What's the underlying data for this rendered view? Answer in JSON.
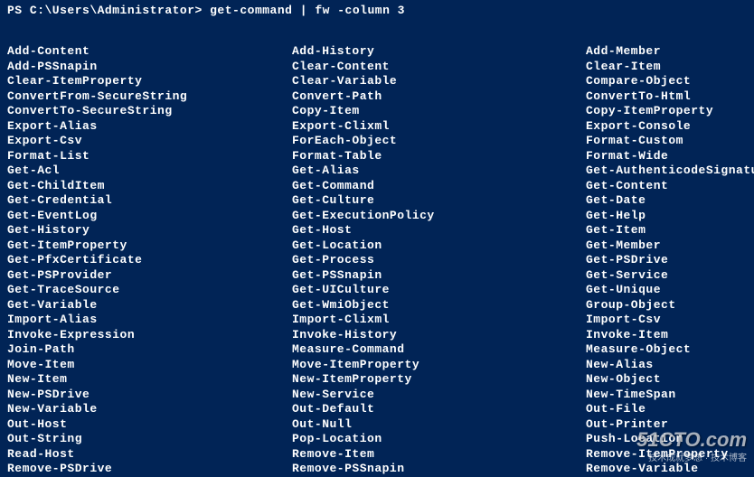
{
  "prompt": "PS C:\\Users\\Administrator> get-command | fw -column 3",
  "columns": {
    "col1": [
      "Add-Content",
      "Add-PSSnapin",
      "Clear-ItemProperty",
      "ConvertFrom-SecureString",
      "ConvertTo-SecureString",
      "Export-Alias",
      "Export-Csv",
      "Format-List",
      "Get-Acl",
      "Get-ChildItem",
      "Get-Credential",
      "Get-EventLog",
      "Get-History",
      "Get-ItemProperty",
      "Get-PfxCertificate",
      "Get-PSProvider",
      "Get-TraceSource",
      "Get-Variable",
      "Import-Alias",
      "Invoke-Expression",
      "Join-Path",
      "Move-Item",
      "New-Item",
      "New-PSDrive",
      "New-Variable",
      "Out-Host",
      "Out-String",
      "Read-Host",
      "Remove-PSDrive"
    ],
    "col2": [
      "Add-History",
      "Clear-Content",
      "Clear-Variable",
      "Convert-Path",
      "Copy-Item",
      "Export-Clixml",
      "ForEach-Object",
      "Format-Table",
      "Get-Alias",
      "Get-Command",
      "Get-Culture",
      "Get-ExecutionPolicy",
      "Get-Host",
      "Get-Location",
      "Get-Process",
      "Get-PSSnapin",
      "Get-UICulture",
      "Get-WmiObject",
      "Import-Clixml",
      "Invoke-History",
      "Measure-Command",
      "Move-ItemProperty",
      "New-ItemProperty",
      "New-Service",
      "Out-Default",
      "Out-Null",
      "Pop-Location",
      "Remove-Item",
      "Remove-PSSnapin"
    ],
    "col3": [
      "Add-Member",
      "Clear-Item",
      "Compare-Object",
      "ConvertTo-Html",
      "Copy-ItemProperty",
      "Export-Console",
      "Format-Custom",
      "Format-Wide",
      "Get-AuthenticodeSignature",
      "Get-Content",
      "Get-Date",
      "Get-Help",
      "Get-Item",
      "Get-Member",
      "Get-PSDrive",
      "Get-Service",
      "Get-Unique",
      "Group-Object",
      "Import-Csv",
      "Invoke-Item",
      "Measure-Object",
      "New-Alias",
      "New-Object",
      "New-TimeSpan",
      "Out-File",
      "Out-Printer",
      "Push-Location",
      "Remove-ItemProperty",
      "Remove-Variable"
    ]
  },
  "watermark": {
    "main": "51CTO.com",
    "sub": "技术成就梦想 · 技术博客"
  }
}
